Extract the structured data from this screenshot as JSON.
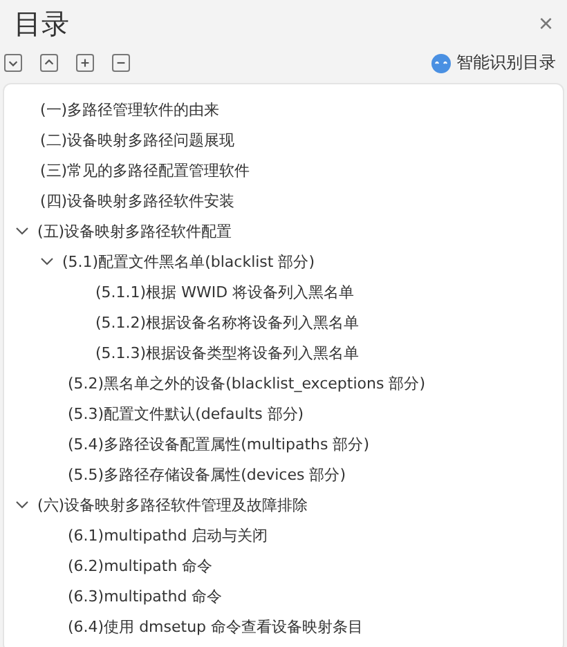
{
  "panel": {
    "title": "目录",
    "close": "×"
  },
  "toolbar": {
    "smart_label": "智能识别目录"
  },
  "toc": [
    {
      "label": "(一)多路径管理软件的由来"
    },
    {
      "label": "(二)设备映射多路径问题展现"
    },
    {
      "label": "(三)常见的多路径配置管理软件"
    },
    {
      "label": "(四)设备映射多路径软件安装"
    },
    {
      "label": "(五)设备映射多路径软件配置",
      "expanded": true,
      "children": [
        {
          "label": "(5.1)配置文件黑名单(blacklist 部分)",
          "expanded": true,
          "children": [
            {
              "label": "(5.1.1)根据 WWID 将设备列入黑名单"
            },
            {
              "label": "(5.1.2)根据设备名称将设备列入黑名单"
            },
            {
              "label": "(5.1.3)根据设备类型将设备列入黑名单"
            }
          ]
        },
        {
          "label": "(5.2)黑名单之外的设备(blacklist_exceptions 部分)"
        },
        {
          "label": "(5.3)配置文件默认(defaults 部分)"
        },
        {
          "label": "(5.4)多路径设备配置属性(multipaths 部分)"
        },
        {
          "label": "(5.5)多路径存储设备属性(devices 部分)"
        }
      ]
    },
    {
      "label": "(六)设备映射多路径软件管理及故障排除",
      "expanded": true,
      "children": [
        {
          "label": "(6.1)multipathd 启动与关闭"
        },
        {
          "label": "(6.2)multipath 命令"
        },
        {
          "label": "(6.3)multipathd 命令"
        },
        {
          "label": "(6.4)使用 dmsetup 命令查看设备映射条目"
        }
      ]
    }
  ]
}
